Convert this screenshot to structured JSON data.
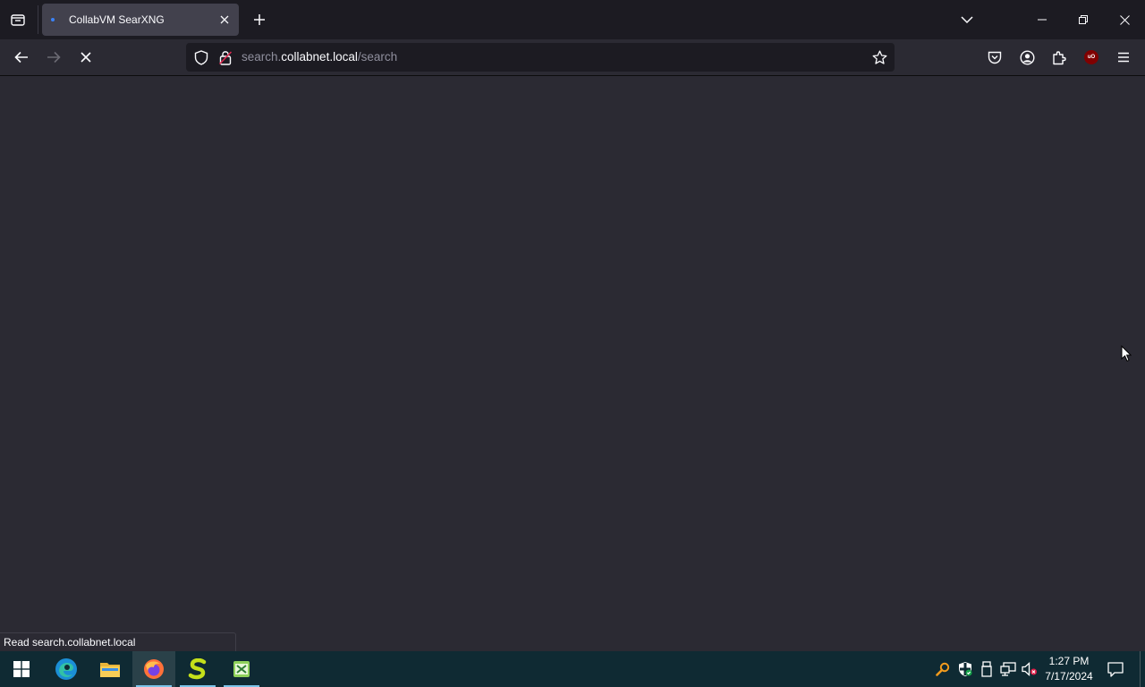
{
  "browser": {
    "tab": {
      "title": "CollabVM SearXNG",
      "favicon_color": "#3b82f6"
    },
    "url": {
      "prefix": "search.",
      "domain": "collabnet.local",
      "path": "/search"
    },
    "status_text": "Read search.collabnet.local",
    "colors": {
      "chrome": "#1c1b22",
      "toolbar": "#2b2a33",
      "content": "#2b2a33",
      "tab_active": "#42414d",
      "ublock": "#800000"
    }
  },
  "icons": {
    "tab_list": "tab-list-icon",
    "tab_close": "close-icon",
    "new_tab": "plus-icon",
    "list_all_tabs": "chevron-down-icon",
    "back": "arrow-left-icon",
    "forward": "arrow-right-icon",
    "stop": "stop-icon",
    "tracking": "shield-icon",
    "lock": "lock-icon",
    "bookmark": "star-icon",
    "pocket": "pocket-icon",
    "account": "account-icon",
    "extensions": "puzzle-icon",
    "ublock": "ublock-icon",
    "menu": "hamburger-icon"
  },
  "taskbar": {
    "apps": [
      "start",
      "edge",
      "file-explorer",
      "firefox",
      "app-s",
      "app-x"
    ],
    "clock": {
      "time": "1:27 PM",
      "date": "7/17/2024"
    }
  }
}
